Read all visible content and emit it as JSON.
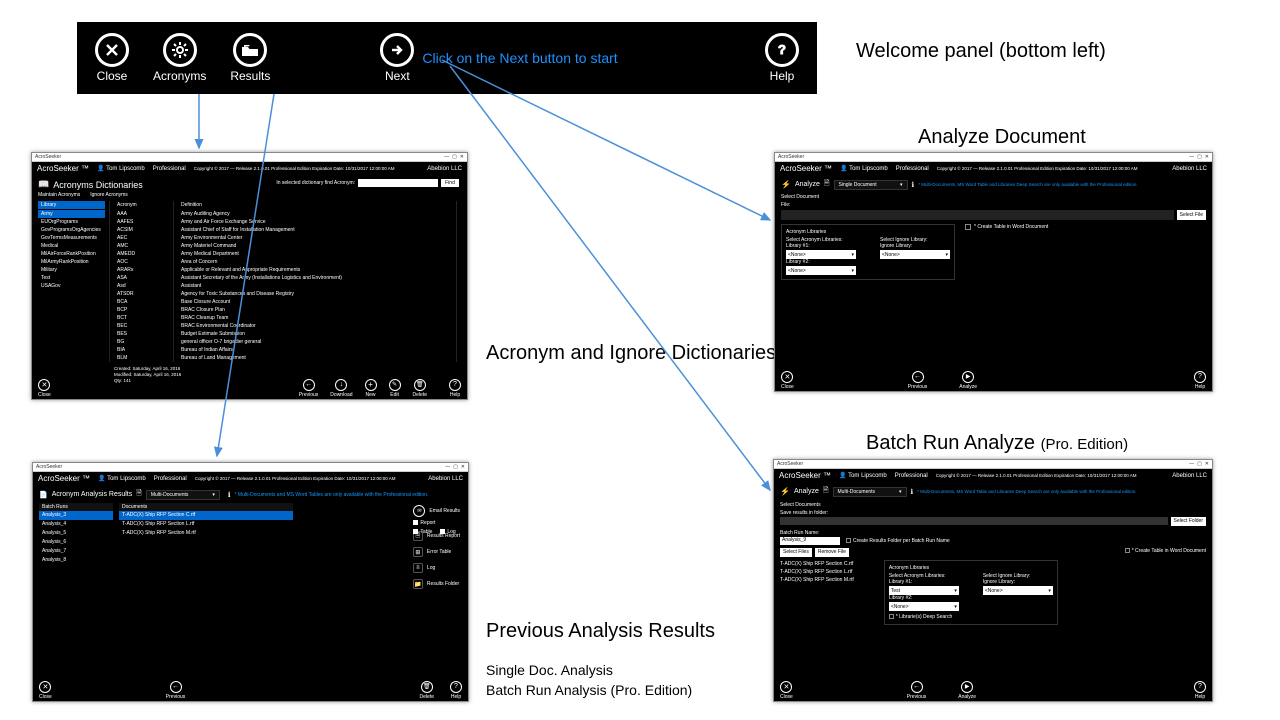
{
  "toolbar": {
    "close": "Close",
    "acronyms": "Acronyms",
    "results": "Results",
    "next": "Next",
    "help": "Help",
    "hint": "Click on the Next button to start"
  },
  "captions": {
    "welcome": "Welcome panel (bottom left)",
    "acr": "Acronym and Ignore Dictionaries",
    "analyze": "Analyze Document",
    "batch": "Batch Run Analyze",
    "batch_note": "(Pro. Edition)",
    "results": "Previous Analysis Results",
    "results_sub1": "Single Doc. Analysis",
    "results_sub2": "Batch Run Analysis (Pro. Edition)"
  },
  "app": {
    "chrome_title": "AcroSeeker",
    "brand": "AcroSeeker ™",
    "user": "Tom Lipscomb",
    "edition": "Professional",
    "copyright": "Copyright © 2017 — Release 2.1.0.01  Professional Edition Expiration Date: 10/31/2017 12:00:00 AM",
    "vendor": "Abebion LLC"
  },
  "acr": {
    "title": "Acronyms Dictionaries",
    "tab1": "Maintain Acronyms",
    "tab2": "Ignore Acronyms",
    "search_label": "In selected dictionary find Acronym:",
    "find": "Find",
    "col_library": "Library",
    "col_acronym": "Acronym",
    "col_definition": "Definition",
    "libs": [
      "Army",
      "EUOrgPrograms",
      "GovProgramsOrgAgencies",
      "GovTermsMeasurements",
      "Medical",
      "MilAirForceRankPosition",
      "MilArmyRankPosition",
      "Military",
      "Test",
      "USAGov"
    ],
    "rows": [
      {
        "a": "AAA",
        "d": "Army Auditing Agency"
      },
      {
        "a": "AAFES",
        "d": "Army and Air Force Exchange Service"
      },
      {
        "a": "ACSIM",
        "d": "Assistant Chief of Staff for Installation Management"
      },
      {
        "a": "AEC",
        "d": "Army Environmental Center"
      },
      {
        "a": "AMC",
        "d": "Army Materiel Command"
      },
      {
        "a": "AMEDD",
        "d": "Army Medical Department"
      },
      {
        "a": "AOC",
        "d": "Area of Concern"
      },
      {
        "a": "ARARs",
        "d": "Applicable or Relevant and Appropriate Requirements"
      },
      {
        "a": "ASA",
        "d": "Assistant Secretary of the Army (Installations Logistics and Environment)"
      },
      {
        "a": "Asd",
        "d": "Assistant"
      },
      {
        "a": "ATSDR",
        "d": "Agency for Toxic Substances and Disease Registry"
      },
      {
        "a": "BCA",
        "d": "Base Closure Account"
      },
      {
        "a": "BCP",
        "d": "BRAC Closure Plan"
      },
      {
        "a": "BCT",
        "d": "BRAC Cleanup Team"
      },
      {
        "a": "BEC",
        "d": "BRAC Environmental Coordinator"
      },
      {
        "a": "BES",
        "d": "Budget Estimate Submission"
      },
      {
        "a": "BG",
        "d": "general officer O-7 brigadier general"
      },
      {
        "a": "BIA",
        "d": "Bureau of Indian Affairs"
      },
      {
        "a": "BLM",
        "d": "Bureau of Land Management"
      }
    ],
    "meta_created": "Created: Saturday, April 16, 2016",
    "meta_modified": "Modified: Saturday, April 16, 2016",
    "meta_qty": "Qty: 141",
    "foot": {
      "close": "Close",
      "prev": "Previous",
      "dl": "Download",
      "new": "New",
      "edit": "Edit",
      "del": "Delete",
      "help": "Help"
    }
  },
  "res": {
    "title": "Acronym Analysis Results",
    "mode": "Multi-Documents",
    "info": "* Multi-Documents and MS Word Tables are only available with the Professional edition.",
    "col_runs": "Batch Runs",
    "col_docs": "Documents",
    "runs": [
      "Analysis_3",
      "Analysis_4",
      "Analysis_5",
      "Analysis_6",
      "Analysis_7",
      "Analysis_8"
    ],
    "docs": [
      "T-ADC(X) Ship RFP Section C.rtf",
      "T-ADC(X) Ship RFP Section L.rtf",
      "T-ADC(X) Ship RFP Section M.rtf"
    ],
    "side": {
      "report": "Results Report",
      "error": "Error Table",
      "log": "Log",
      "folder": "Results Folder"
    },
    "email": "Email Results",
    "cb_report": "Report",
    "cb_table": "Table",
    "cb_log": "Log",
    "foot": {
      "close": "Close",
      "prev": "Previous",
      "del": "Delete",
      "help": "Help"
    }
  },
  "ana": {
    "title": "Analyze",
    "mode": "Single Document",
    "info": "* Multi-Documents, MS Word Table and Libraries Deep Search are only available with the Professional edition.",
    "select_doc": "Select Document",
    "file": "File:",
    "select_file": "Select File",
    "acr_lib": "Acronym Libraries",
    "sel_acr": "Select Acronym Libraries:",
    "sel_ign": "Select Ignore Library:",
    "lib1": "Library #1:",
    "lib2": "Library #2:",
    "none": "<None>",
    "ign_lab": "Ignore Library:",
    "create_table": "* Create Table in Word Document",
    "foot": {
      "close": "Close",
      "prev": "Previous",
      "analyze": "Analyze",
      "help": "Help"
    }
  },
  "bat": {
    "title": "Analyze",
    "mode": "Multi-Documents",
    "info": "* Multi-Documents, MS Word Table and Libraries Deep Search are only available with the Professional edition.",
    "select_docs": "Select Documents",
    "save_in": "Save results in folder:",
    "select_folder": "Select Folder",
    "run_name_lab": "Batch Run Name:",
    "run_name": "Analysis_9",
    "create_folder": "Create Results Folder per Batch Run Name",
    "select_files": "Select Files",
    "remove_file": "Remove File",
    "files": [
      "T-ADC(X) Ship RFP Section C.rtf",
      "T-ADC(X) Ship RFP Section L.rtf",
      "T-ADC(X) Ship RFP Section M.rtf"
    ],
    "create_table": "* Create Table in Word Document",
    "acr_lib": "Acronym Libraries",
    "sel_acr": "Select Acronym Libraries:",
    "sel_ign": "Select Ignore Library:",
    "lib1": "Library #1:",
    "lib1v": "Test",
    "lib2": "Library #2:",
    "none": "<None>",
    "ign_lab": "Ignore Library:",
    "deep": "* Librarie(s) Deep Search",
    "foot": {
      "close": "Close",
      "prev": "Previous",
      "analyze": "Analyze",
      "help": "Help"
    }
  }
}
